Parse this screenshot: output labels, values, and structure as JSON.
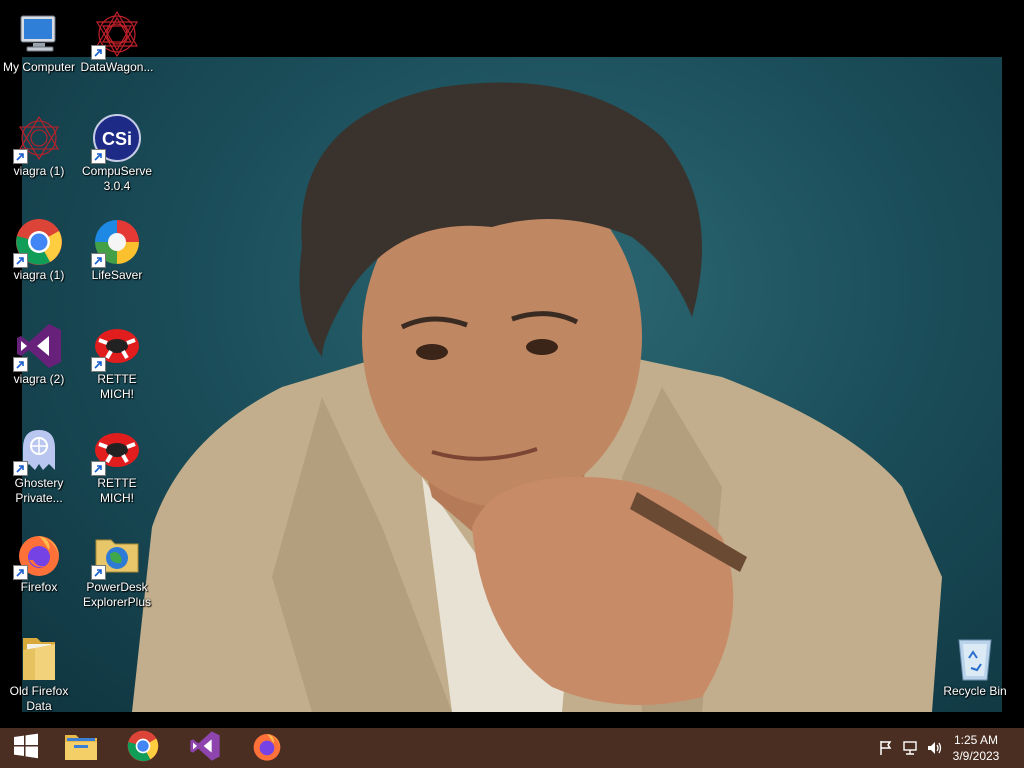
{
  "desktop": {
    "icons": [
      {
        "label": "My Computer",
        "icon": "my-computer-icon"
      },
      {
        "label": "DataWagon...",
        "icon": "datawagon-icon"
      },
      {
        "label": "viagra (1)",
        "icon": "spirograph-icon"
      },
      {
        "label": "CompuServe 3.0.4",
        "icon": "compuserve-icon"
      },
      {
        "label": "viagra (1)",
        "icon": "chrome-icon"
      },
      {
        "label": "LifeSaver",
        "icon": "lifesaver-icon"
      },
      {
        "label": "viagra (2)",
        "icon": "visual-studio-icon"
      },
      {
        "label": "RETTE MICH!",
        "icon": "life-ring-icon"
      },
      {
        "label": "Ghostery Private...",
        "icon": "ghostery-icon"
      },
      {
        "label": "RETTE MICH!",
        "icon": "life-ring-icon"
      },
      {
        "label": "Firefox",
        "icon": "firefox-icon"
      },
      {
        "label": "PowerDesk ExplorerPlus",
        "icon": "powerdesk-icon"
      },
      {
        "label": "Old Firefox Data",
        "icon": "folder-icon"
      },
      {
        "label": "Recycle Bin",
        "icon": "recycle-bin-icon"
      }
    ]
  },
  "taskbar": {
    "start": "windows-start-icon",
    "pinned": [
      "file-explorer-icon",
      "chrome-icon",
      "visual-studio-icon",
      "firefox-icon"
    ],
    "tray": [
      "flag-icon",
      "network-icon",
      "volume-icon"
    ],
    "clock": {
      "time": "1:25 AM",
      "date": "3/9/2023"
    }
  },
  "colors": {
    "taskbar": "#4a2e22",
    "wallpaper": "#1b4f5b"
  }
}
